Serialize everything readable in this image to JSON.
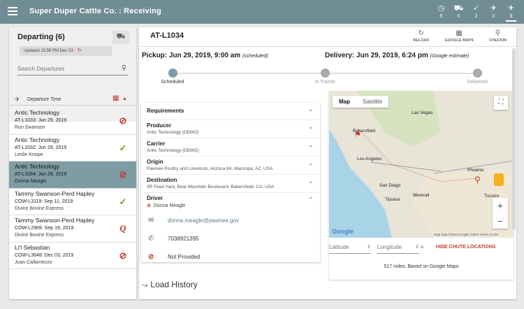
{
  "header": {
    "app_title": "Super Duper Cattle Co. : Receiving",
    "icons": [
      {
        "name": "clock-icon",
        "glyph": "◷",
        "count": "9"
      },
      {
        "name": "truck-icon",
        "glyph": "⛟",
        "count": "0"
      },
      {
        "name": "check-icon",
        "glyph": "✓",
        "count": "2"
      },
      {
        "name": "landing-icon",
        "glyph": "✈",
        "count": "0"
      },
      {
        "name": "departure-icon",
        "glyph": "✈",
        "count": "6"
      }
    ]
  },
  "left": {
    "title": "Departing (6)",
    "updated": "Updated 15:58 PM Dec 03",
    "search_placeholder": "Search Departures",
    "sort_label": "Departure Time",
    "items": [
      {
        "name": "Antic Technology",
        "code": "AT-L1033: Jun 29, 2019",
        "person": "Ron Swanson",
        "status": "blocked"
      },
      {
        "name": "Antic Technology",
        "code": "AT-L1032: Jun 29, 2019",
        "person": "Leslie Knope",
        "status": "check"
      },
      {
        "name": "Antic Technology",
        "code": "AT-L1034: Jun 29, 2019",
        "person": "Donna Meagle",
        "status": "blocked",
        "selected": true
      },
      {
        "name": "Tammy Swanson-Perd Hapley",
        "code": "COW-L3119: Sep 11, 2019",
        "person": "Divine Bovine Express",
        "status": "check"
      },
      {
        "name": "Tammy Swanson-Perd Hapley",
        "code": "COW-L2969: Sep 19, 2019",
        "person": "Divine Bovine Express",
        "status": "q"
      },
      {
        "name": "Li'l Sebastian",
        "code": "COW-L3648: Dec 03, 2019",
        "person": "Joan Callamezzo",
        "status": "blocked"
      }
    ]
  },
  "detail": {
    "id": "AT-L1034",
    "actions": {
      "reload": "RELOAD",
      "maps": "GOOGLE MAPS",
      "checkin": "CHECKIN"
    },
    "pickup_main": "Pickup: Jun 29, 2019, 9:00 am",
    "pickup_note": "(scheduled)",
    "delivery_main": "Delivery: Jun 29, 2019, 6:24 pm",
    "delivery_note": "(Google estimate)",
    "stages": [
      "Scheduled",
      "In Transit",
      "Delivered"
    ],
    "requirements": "Requirements",
    "producer_label": "Producer",
    "producer": "Antic Technology (DEMO)",
    "carrier_label": "Carrier",
    "carrier": "Antic Technology (DEMO)",
    "origin_label": "Origin",
    "origin": "Pawnee Poultry and Livestock, Arizona 84, Maricopa, AZ, USA",
    "destination_label": "Destination",
    "destination": "3R Feed Yard, Bear Mountain Boulevard, Bakersfield, CA, USA",
    "driver_label": "Driver",
    "driver_name": "Donna Meagle",
    "email": "donna.meagle@pawnee.gov",
    "phone": "7038921395",
    "provided": "Not Provided",
    "load_history": "Load History"
  },
  "map": {
    "tab_map": "Map",
    "tab_satellite": "Satellite",
    "google": "Google",
    "attribution": "Map data ©2019 Google, INEGI  Terms of Use",
    "cities": [
      "Las Vegas",
      "Bakersfield",
      "Los Angeles",
      "San Diego",
      "Tijuana",
      "Mexicali",
      "Phoenix",
      "Tucson"
    ],
    "lat_placeholder": "Latitude",
    "lng_placeholder": "Longitude",
    "hide_chute": "HIDE CHUTE LOCATIONS",
    "miles": "517 miles. Based on Google Maps"
  }
}
